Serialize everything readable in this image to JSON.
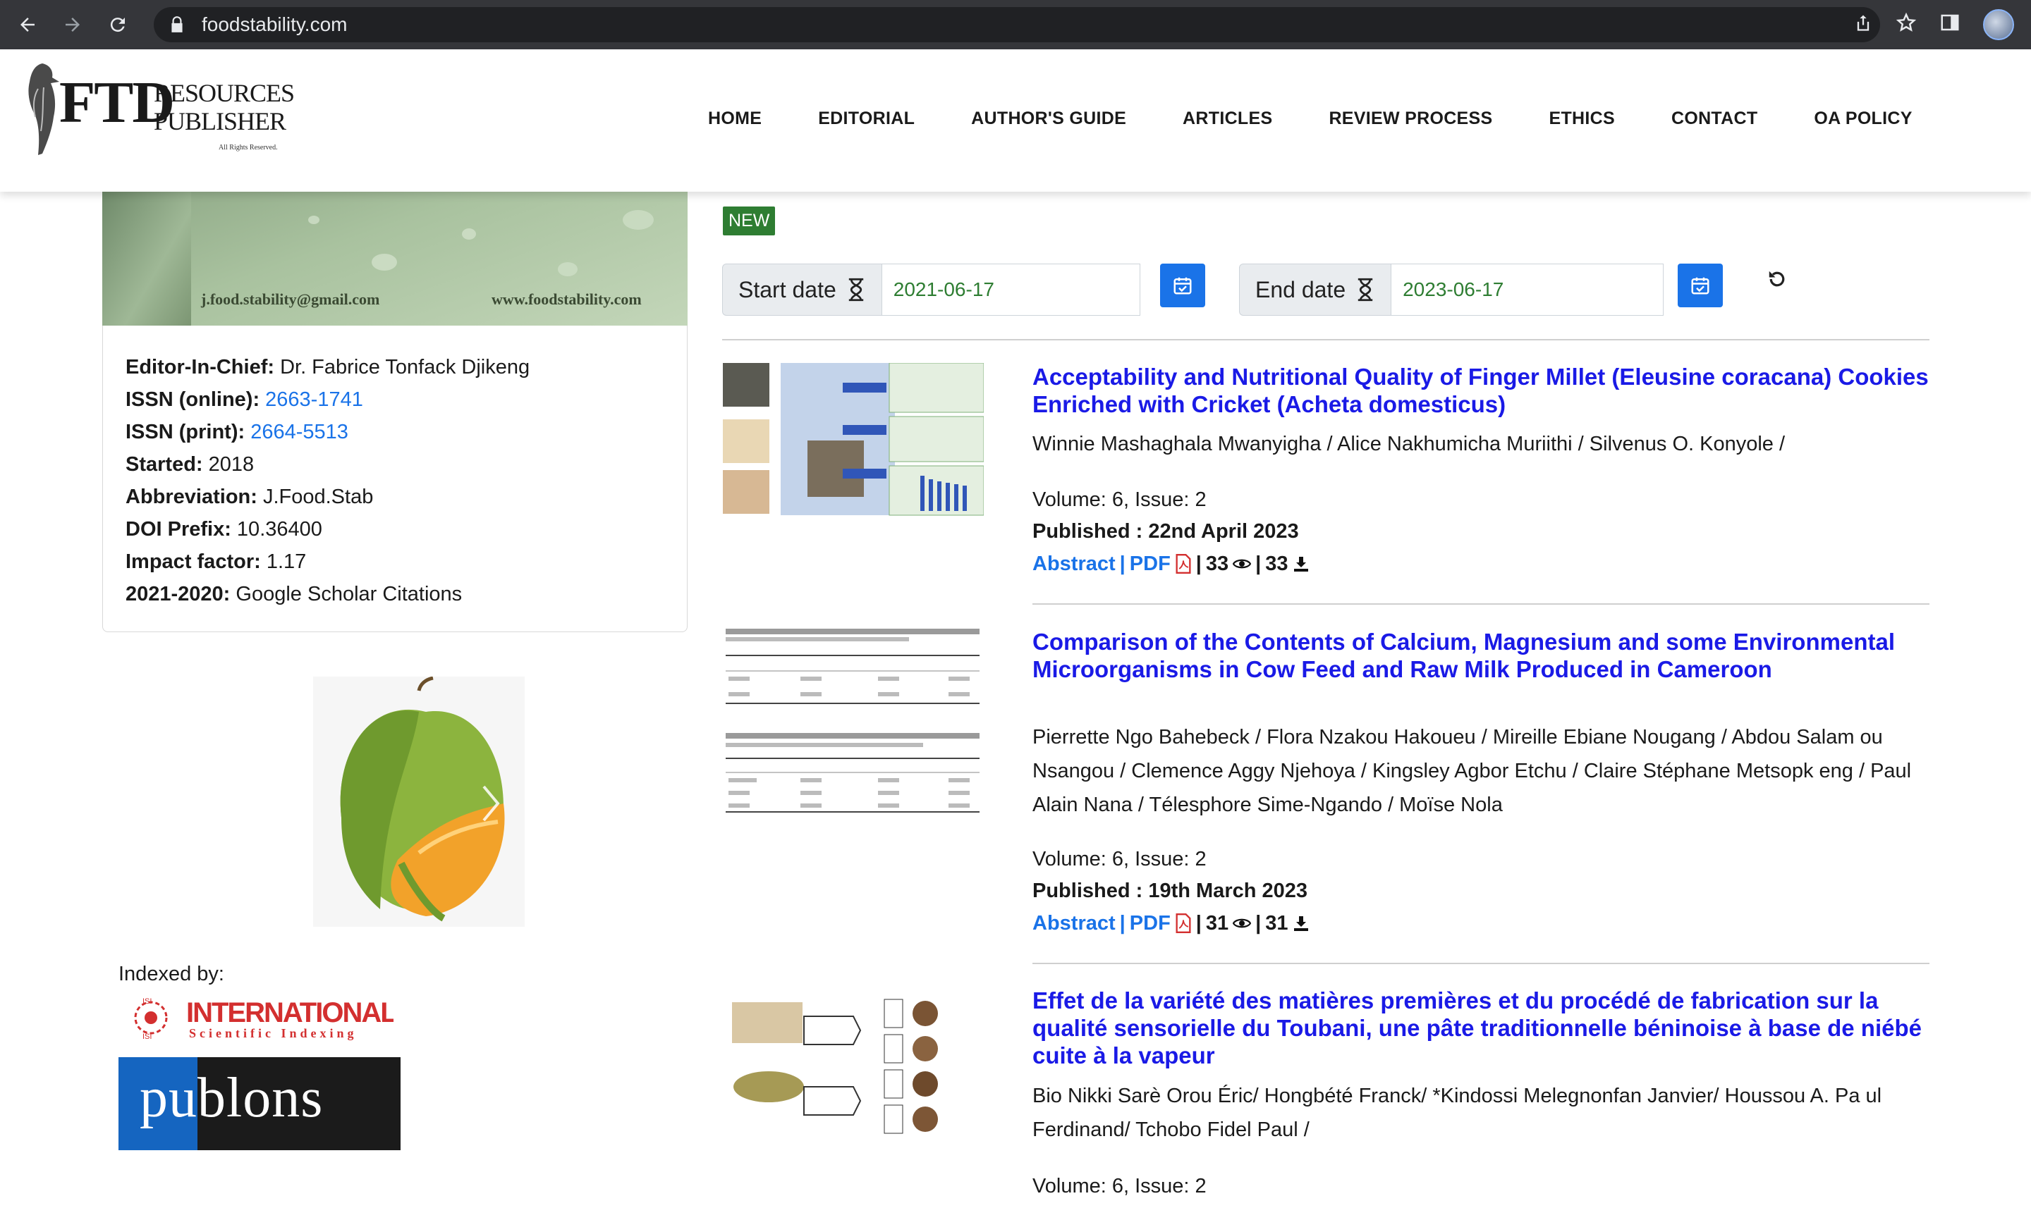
{
  "browser": {
    "url": "foodstability.com"
  },
  "logo": {
    "big": "FTD",
    "line1": "RESOURCES",
    "line2": "PUBLISHER",
    "rights": "All Rights Reserved."
  },
  "nav": [
    "HOME",
    "EDITORIAL",
    "AUTHOR'S GUIDE",
    "ARTICLES",
    "REVIEW PROCESS",
    "ETHICS",
    "CONTACT",
    "OA POLICY"
  ],
  "banner": {
    "email": "j.food.stability@gmail.com",
    "website": "www.foodstability.com"
  },
  "journal_info": [
    {
      "label": "Editor-In-Chief:",
      "value": "  Dr. Fabrice Tonfack Djikeng",
      "link": false
    },
    {
      "label": "ISSN (online):",
      "value": " 2663-1741",
      "link": true
    },
    {
      "label": "ISSN (print):",
      "value": " 2664-5513",
      "link": true
    },
    {
      "label": "Started:",
      "value": " 2018",
      "link": false
    },
    {
      "label": "Abbreviation:",
      "value": " J.Food.Stab",
      "link": false
    },
    {
      "label": "DOI Prefix:",
      "value": " 10.36400",
      "link": false
    },
    {
      "label": "Impact factor:",
      "value": " 1.17",
      "link": false
    },
    {
      "label": "2021-2020:",
      "value": " Google Scholar Citations",
      "link": false
    }
  ],
  "indexed_by": "Indexed by:",
  "isi": {
    "line1": "INTERNATIONAL",
    "line2": "Scientific Indexing",
    "mark": "ISI"
  },
  "publons": "publons",
  "new_badge": "NEW",
  "filters": {
    "start_label": "Start date",
    "start_value": "2021-06-17",
    "end_label": "End date",
    "end_value": "2023-06-17"
  },
  "articles": [
    {
      "title": "Acceptability and Nutritional Quality of Finger Millet (Eleusine coracana) Cookies Enriched with Cricket (Acheta domesticus)",
      "authors": "Winnie Mashaghala Mwanyigha / Alice Nakhumicha Muriithi / Silvenus O. Konyole /",
      "volume": "Volume: 6, Issue: 2",
      "published_label": "Published : ",
      "published_date": " 22nd April 2023",
      "abstract": "Abstract",
      "pdf": "PDF",
      "views": "33",
      "downloads": "33"
    },
    {
      "title": "Comparison of the Contents of Calcium, Magnesium and some Environmental Microorganisms in Cow Feed and Raw Milk Produced in Cameroon",
      "authors": "Pierrette Ngo Bahebeck / Flora Nzakou Hakoueu / Mireille Ebiane Nougang / Abdou Salam ou Nsangou / Clemence Aggy Njehoya / Kingsley Agbor Etchu / Claire Stéphane Metsopk eng / Paul Alain Nana / Télesphore Sime-Ngando / Moïse Nola",
      "volume": "Volume: 6, Issue: 2",
      "published_label": "Published : ",
      "published_date": " 19th March 2023",
      "abstract": "Abstract",
      "pdf": "PDF",
      "views": "31",
      "downloads": "31"
    },
    {
      "title": "Effet de la variété des matières premières et du procédé de fabrication sur la qualité sensorielle du Toubani, une pâte traditionnelle béninoise à base de niébé cuite à la vapeur",
      "authors": "Bio Nikki Sarè Orou Éric/ Hongbété Franck/ *Kindossi Melegnonfan Janvier/ Houssou A. Pa ul Ferdinand/ Tchobo Fidel Paul /",
      "volume": "Volume: 6, Issue: 2"
    }
  ],
  "colors": {
    "title_blue": "#1a1ae6",
    "link_blue": "#1a73e8",
    "new_green": "#2e7d32",
    "pdf_red": "#d32f2f"
  },
  "icons": [
    "back-arrow-icon",
    "forward-arrow-icon",
    "reload-icon",
    "lock-icon",
    "share-icon",
    "star-icon",
    "sidebar-icon",
    "hourglass-icon",
    "calendar-icon",
    "reset-icon",
    "pdf-icon",
    "eye-icon",
    "download-icon",
    "chevron-right-icon"
  ]
}
